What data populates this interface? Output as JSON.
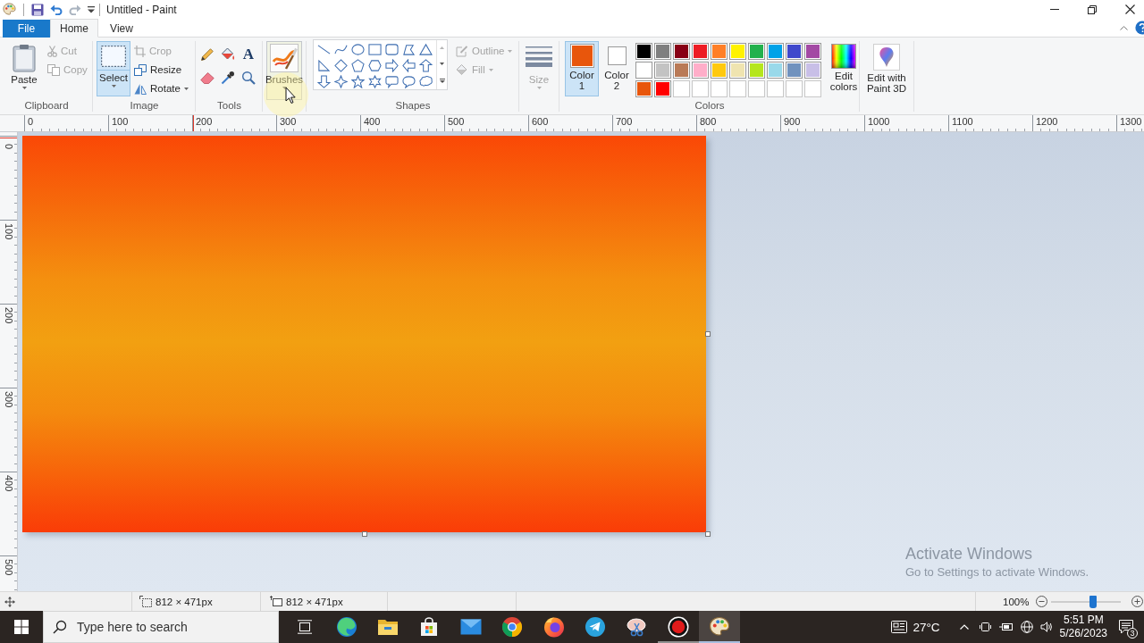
{
  "title_bar": {
    "title": "Untitled - Paint",
    "quick_access": [
      {
        "kind": "save",
        "disabled": false
      },
      {
        "kind": "undo",
        "disabled": false
      },
      {
        "kind": "redo",
        "disabled": true
      }
    ]
  },
  "file_menu": {
    "label": "File"
  },
  "tabs": [
    {
      "label": "Home",
      "selected": true
    },
    {
      "label": "View",
      "selected": false
    }
  ],
  "ribbon": {
    "clipboard": {
      "label": "Clipboard",
      "paste": {
        "label": "Paste"
      },
      "items": [
        {
          "kind": "cut",
          "label": "Cut",
          "disabled": true
        },
        {
          "kind": "copy",
          "label": "Copy",
          "disabled": true
        }
      ]
    },
    "image": {
      "label": "Image",
      "select": {
        "label": "Select",
        "selected": true
      },
      "items": [
        {
          "kind": "crop",
          "label": "Crop",
          "disabled": true,
          "dropdown": false
        },
        {
          "kind": "resize",
          "label": "Resize",
          "disabled": false,
          "dropdown": false
        },
        {
          "kind": "rotate",
          "label": "Rotate",
          "disabled": false,
          "dropdown": true
        }
      ]
    },
    "tools": {
      "label": "Tools",
      "items": [
        {
          "kind": "pencil",
          "selected": false
        },
        {
          "kind": "fill",
          "selected": false
        },
        {
          "kind": "text",
          "glyph": "A",
          "selected": false
        },
        {
          "kind": "eraser",
          "selected": false
        },
        {
          "kind": "picker",
          "selected": false
        },
        {
          "kind": "magnifier",
          "selected": false
        }
      ]
    },
    "brushes": {
      "label": "Brushes",
      "hovered": true
    },
    "shapes": {
      "label": "Shapes",
      "outline": {
        "label": "Outline",
        "disabled": true
      },
      "fill": {
        "label": "Fill",
        "disabled": true
      }
    },
    "size": {
      "label": "Size",
      "disabled": true
    },
    "colors": {
      "label": "Colors",
      "active": [
        {
          "label": "Color 1",
          "color": "#e8560c",
          "selected": true
        },
        {
          "label": "Color 2",
          "color": "#ffffff",
          "selected": false
        }
      ],
      "palette": [
        [
          {
            "kind": "swatch",
            "color": "#000000"
          },
          {
            "kind": "swatch",
            "color": "#7f7f7f"
          },
          {
            "kind": "swatch",
            "color": "#880015"
          },
          {
            "kind": "swatch",
            "color": "#ed1c24"
          },
          {
            "kind": "swatch",
            "color": "#ff7f27"
          },
          {
            "kind": "swatch",
            "color": "#fff200"
          },
          {
            "kind": "swatch",
            "color": "#22b14c"
          },
          {
            "kind": "swatch",
            "color": "#00a2e8"
          },
          {
            "kind": "swatch",
            "color": "#3f48cc"
          },
          {
            "kind": "swatch",
            "color": "#a349a4"
          }
        ],
        [
          {
            "kind": "swatch",
            "color": "#ffffff"
          },
          {
            "kind": "swatch",
            "color": "#c3c3c3"
          },
          {
            "kind": "swatch",
            "color": "#b97a57"
          },
          {
            "kind": "swatch",
            "color": "#ffaec9"
          },
          {
            "kind": "swatch",
            "color": "#ffc90e"
          },
          {
            "kind": "swatch",
            "color": "#efe4b0"
          },
          {
            "kind": "swatch",
            "color": "#b5e61d"
          },
          {
            "kind": "swatch",
            "color": "#99d9ea"
          },
          {
            "kind": "swatch",
            "color": "#7092be"
          },
          {
            "kind": "swatch",
            "color": "#c8bfe7"
          }
        ],
        [
          {
            "kind": "swatch",
            "color": "#e8560c"
          },
          {
            "kind": "swatch",
            "color": "#ff0000"
          },
          {
            "kind": "empty"
          },
          {
            "kind": "empty"
          },
          {
            "kind": "empty"
          },
          {
            "kind": "empty"
          },
          {
            "kind": "empty"
          },
          {
            "kind": "empty"
          },
          {
            "kind": "empty"
          },
          {
            "kind": "empty"
          }
        ]
      ],
      "edit": {
        "label": "Edit colors"
      }
    },
    "paint3d": {
      "label": "Edit with Paint 3D"
    }
  },
  "rulers": {
    "horizontal": [
      "0",
      "100",
      "200",
      "300",
      "400",
      "500",
      "600",
      "700",
      "800",
      "900",
      "1000",
      "1100",
      "1200",
      "1300"
    ],
    "vertical": [
      "0",
      "100",
      "200",
      "300",
      "400",
      "500"
    ]
  },
  "status_bar": {
    "selection_size": "812 × 471px",
    "canvas_size": "812 × 471px",
    "zoom": {
      "reading": "100%",
      "level": 0.6
    }
  },
  "activation_notice": {
    "title": "Activate Windows",
    "message": "Go to Settings to activate Windows."
  },
  "taskbar": {
    "search": {
      "placeholder": "Type here to search"
    },
    "apps": [
      {
        "kind": "task_view",
        "open": false,
        "active": false
      },
      {
        "kind": "edge",
        "open": false,
        "active": false
      },
      {
        "kind": "explorer",
        "open": false,
        "active": false
      },
      {
        "kind": "store",
        "open": false,
        "active": false
      },
      {
        "kind": "mail",
        "open": false,
        "active": false
      },
      {
        "kind": "chrome",
        "open": false,
        "active": false
      },
      {
        "kind": "firefox",
        "open": false,
        "active": false
      },
      {
        "kind": "telegram",
        "open": false,
        "active": false
      },
      {
        "kind": "snip",
        "open": false,
        "active": false
      },
      {
        "kind": "recorder",
        "open": true,
        "active": false
      },
      {
        "kind": "paint",
        "open": true,
        "active": true
      }
    ],
    "weather": "27°C",
    "clock": {
      "time": "5:51 PM",
      "date": "5/26/2023"
    },
    "notification_count": "3"
  }
}
